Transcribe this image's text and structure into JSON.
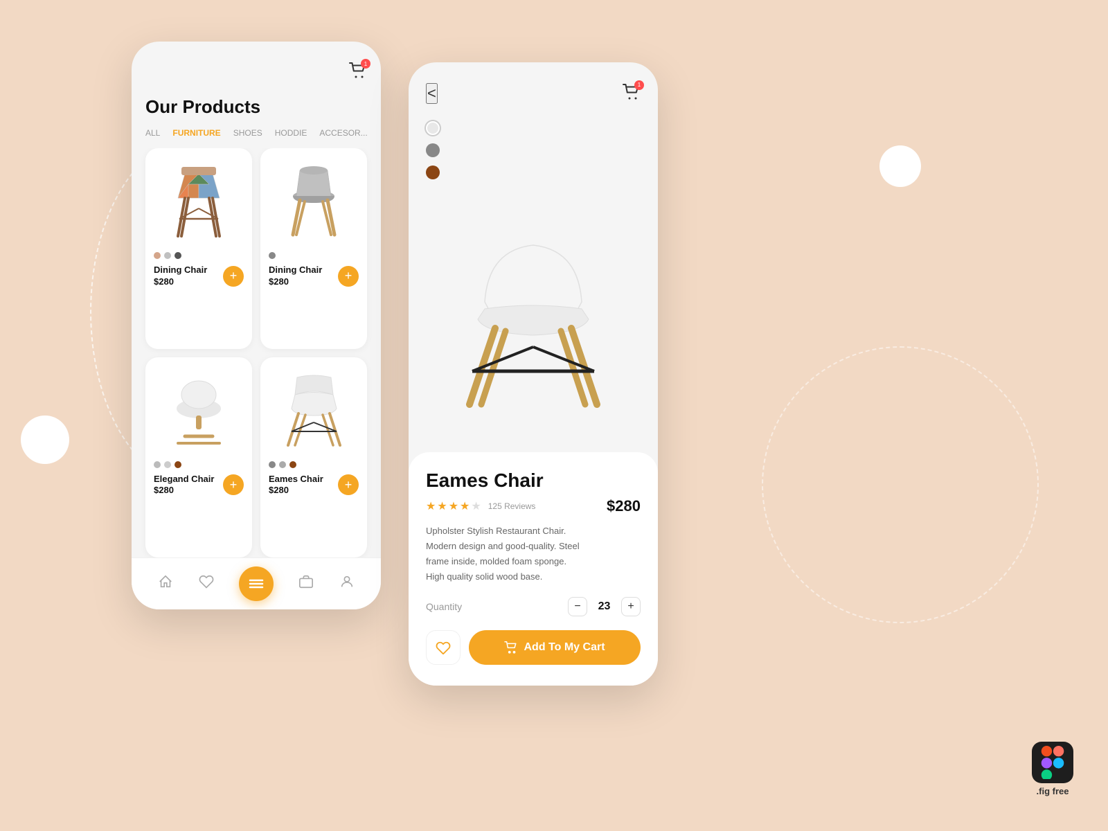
{
  "background": {
    "color": "#f2d9c4"
  },
  "phone1": {
    "title": "Our Products",
    "cart_badge": "1",
    "categories": [
      {
        "label": "ALL",
        "active": false
      },
      {
        "label": "FURNITURE",
        "active": true
      },
      {
        "label": "SHOES",
        "active": false
      },
      {
        "label": "HODDIE",
        "active": false
      },
      {
        "label": "ACCESOR...",
        "active": false
      }
    ],
    "products": [
      {
        "name": "Dining Chair",
        "price": "$280",
        "colors": [
          "#d4a58a",
          "#c0c0c0",
          "#555"
        ],
        "type": "colorful"
      },
      {
        "name": "Dining Chair",
        "price": "$280",
        "colors": [
          "#888"
        ],
        "type": "gray-beige"
      },
      {
        "name": "Elegand Chair",
        "price": "$280",
        "colors": [
          "#bbb",
          "#ccc",
          "#8B4513"
        ],
        "type": "white-round"
      },
      {
        "name": "Eames Chair",
        "price": "$280",
        "colors": [
          "#888",
          "#aaa",
          "#8B4513"
        ],
        "type": "eames-white"
      }
    ],
    "nav": {
      "items": [
        "home",
        "heart",
        "menu",
        "bag",
        "person"
      ]
    }
  },
  "phone2": {
    "product": {
      "name": "Eames Chair",
      "price": "$280",
      "rating": 4,
      "review_count": "125 Reviews",
      "description": "Upholster Stylish Restaurant Chair.\nModern design and good-quality. Steel\nframe inside, molded foam sponge.\nHigh quality solid wood base.",
      "quantity": "23",
      "colors": [
        {
          "color": "#e8e8e8",
          "selected": true
        },
        {
          "color": "#888888",
          "selected": false
        },
        {
          "color": "#8B4513",
          "selected": false
        }
      ]
    },
    "buttons": {
      "back": "<",
      "add_to_cart": "Add To My Cart"
    }
  },
  "figma": {
    "label": ".fig free"
  }
}
